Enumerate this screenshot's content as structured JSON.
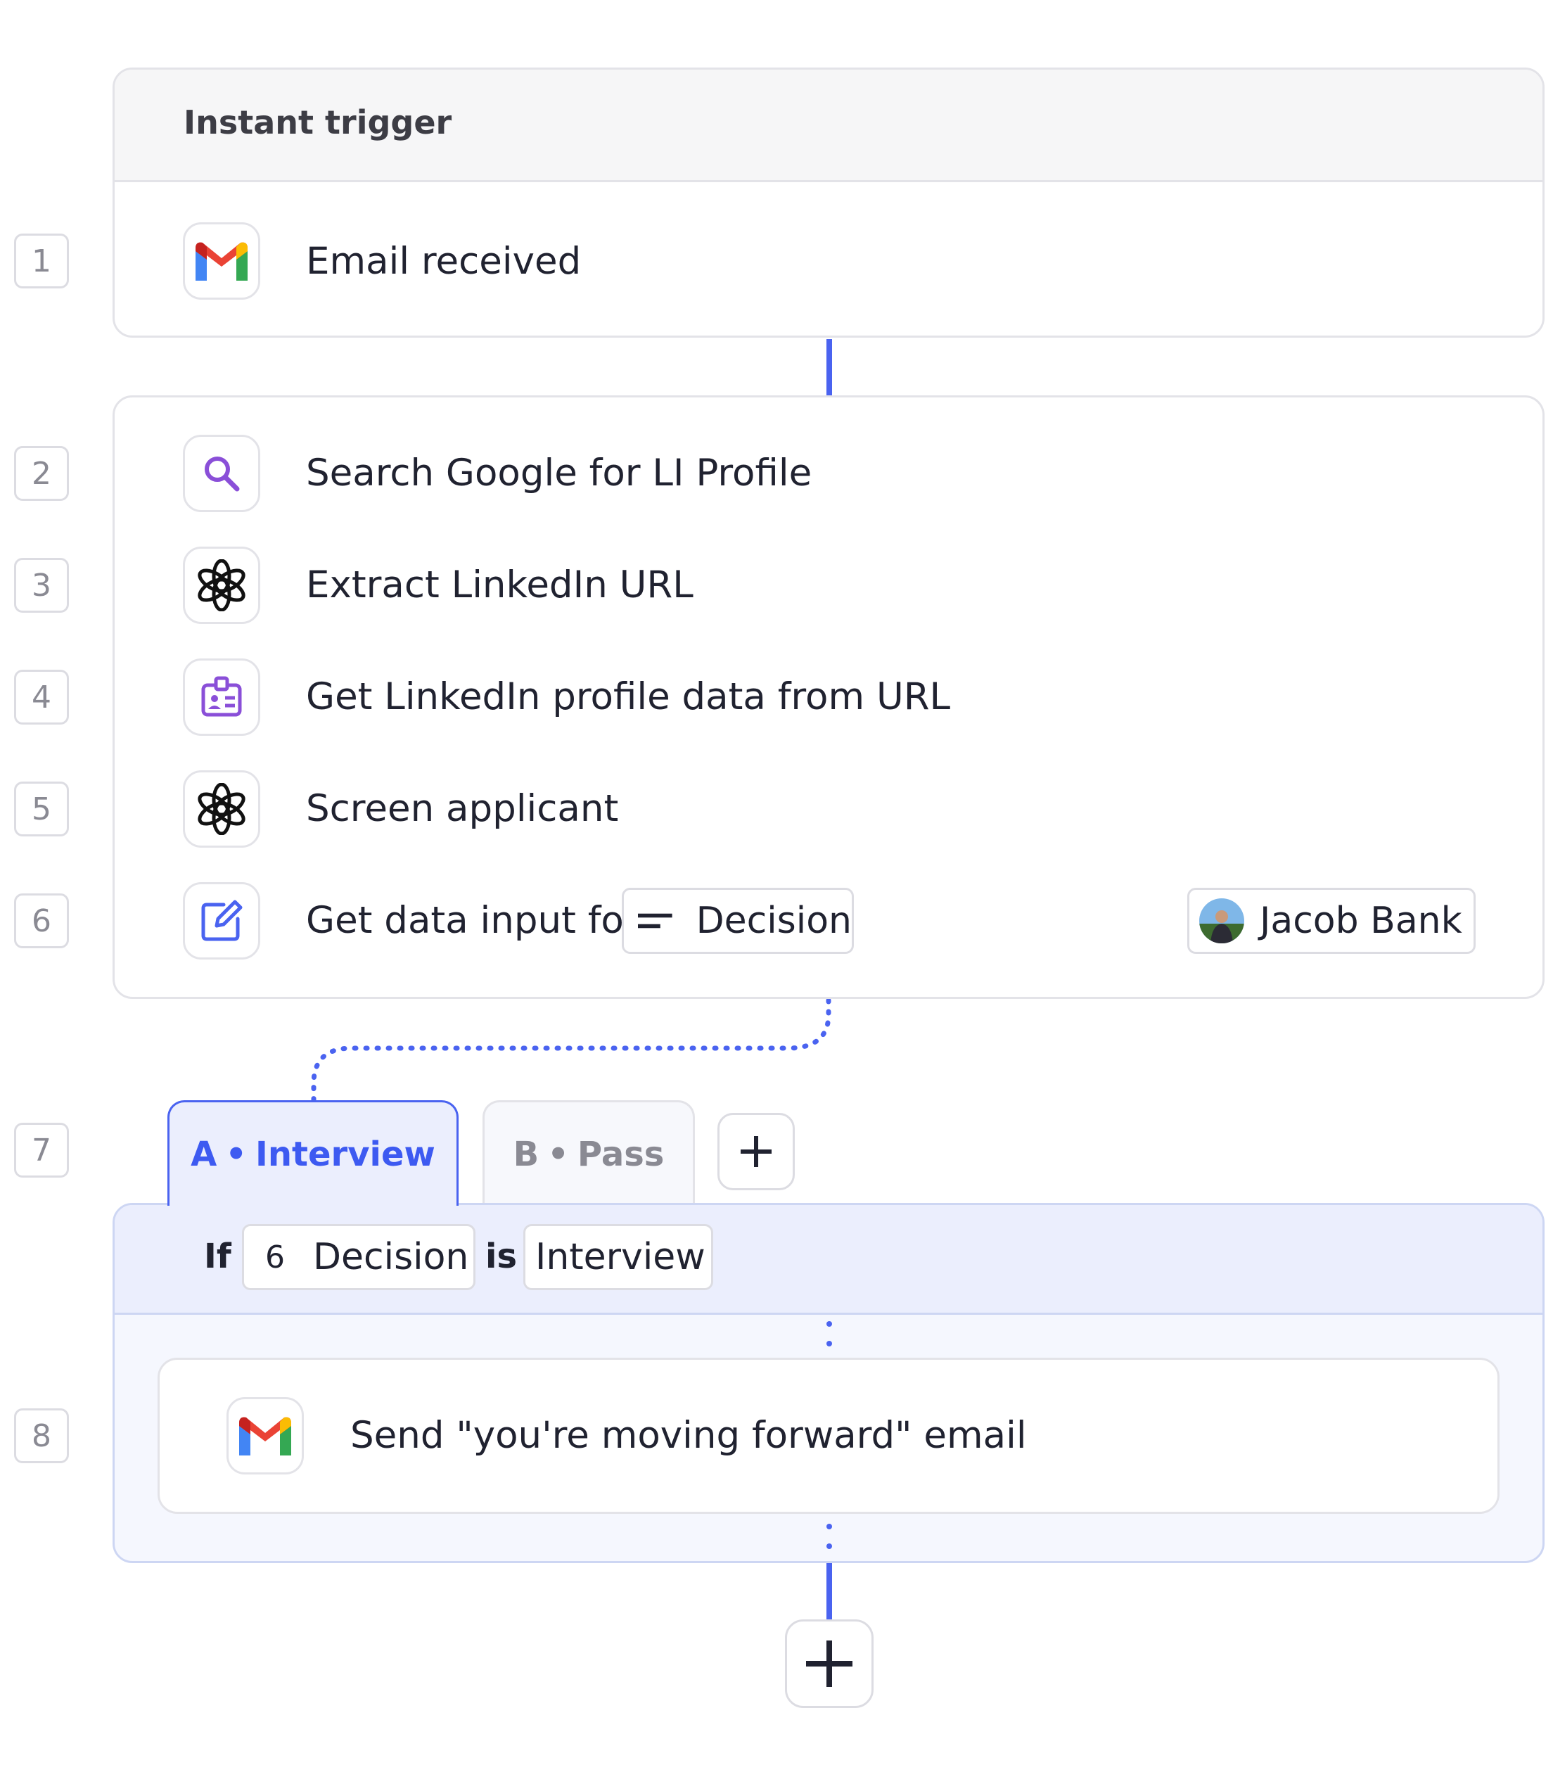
{
  "trigger": {
    "header": "Instant trigger",
    "step_number": "1",
    "label": "Email received",
    "icon": "gmail-icon"
  },
  "steps": [
    {
      "number": "2",
      "label": "Search Google for LI Profile",
      "icon": "search-icon"
    },
    {
      "number": "3",
      "label": "Extract LinkedIn URL",
      "icon": "openai-icon"
    },
    {
      "number": "4",
      "label": "Get LinkedIn profile data from URL",
      "icon": "id-badge-icon"
    },
    {
      "number": "5",
      "label": "Screen applicant",
      "icon": "openai-icon"
    },
    {
      "number": "6",
      "label": "Get data input for",
      "icon": "edit-icon",
      "field_chip": "Decision",
      "assignee": "Jacob Bank"
    }
  ],
  "branch": {
    "step_number": "7",
    "tabs": [
      {
        "prefix": "A",
        "name": "Interview",
        "active": true
      },
      {
        "prefix": "B",
        "name": "Pass",
        "active": false
      }
    ],
    "separator": "•",
    "add_label": "+",
    "condition": {
      "if_label": "If",
      "ref_number": "6",
      "ref_field": "Decision",
      "operator": "is",
      "value": "Interview"
    },
    "action": {
      "step_number": "8",
      "label": "Send \"you're moving forward\" email",
      "icon": "gmail-icon"
    }
  },
  "colors": {
    "accent": "#4a63f0",
    "branch_bg": "#ebeefd",
    "border": "#e3e3e8",
    "openai": "#111111",
    "purple_icon": "#8a4fd8"
  }
}
